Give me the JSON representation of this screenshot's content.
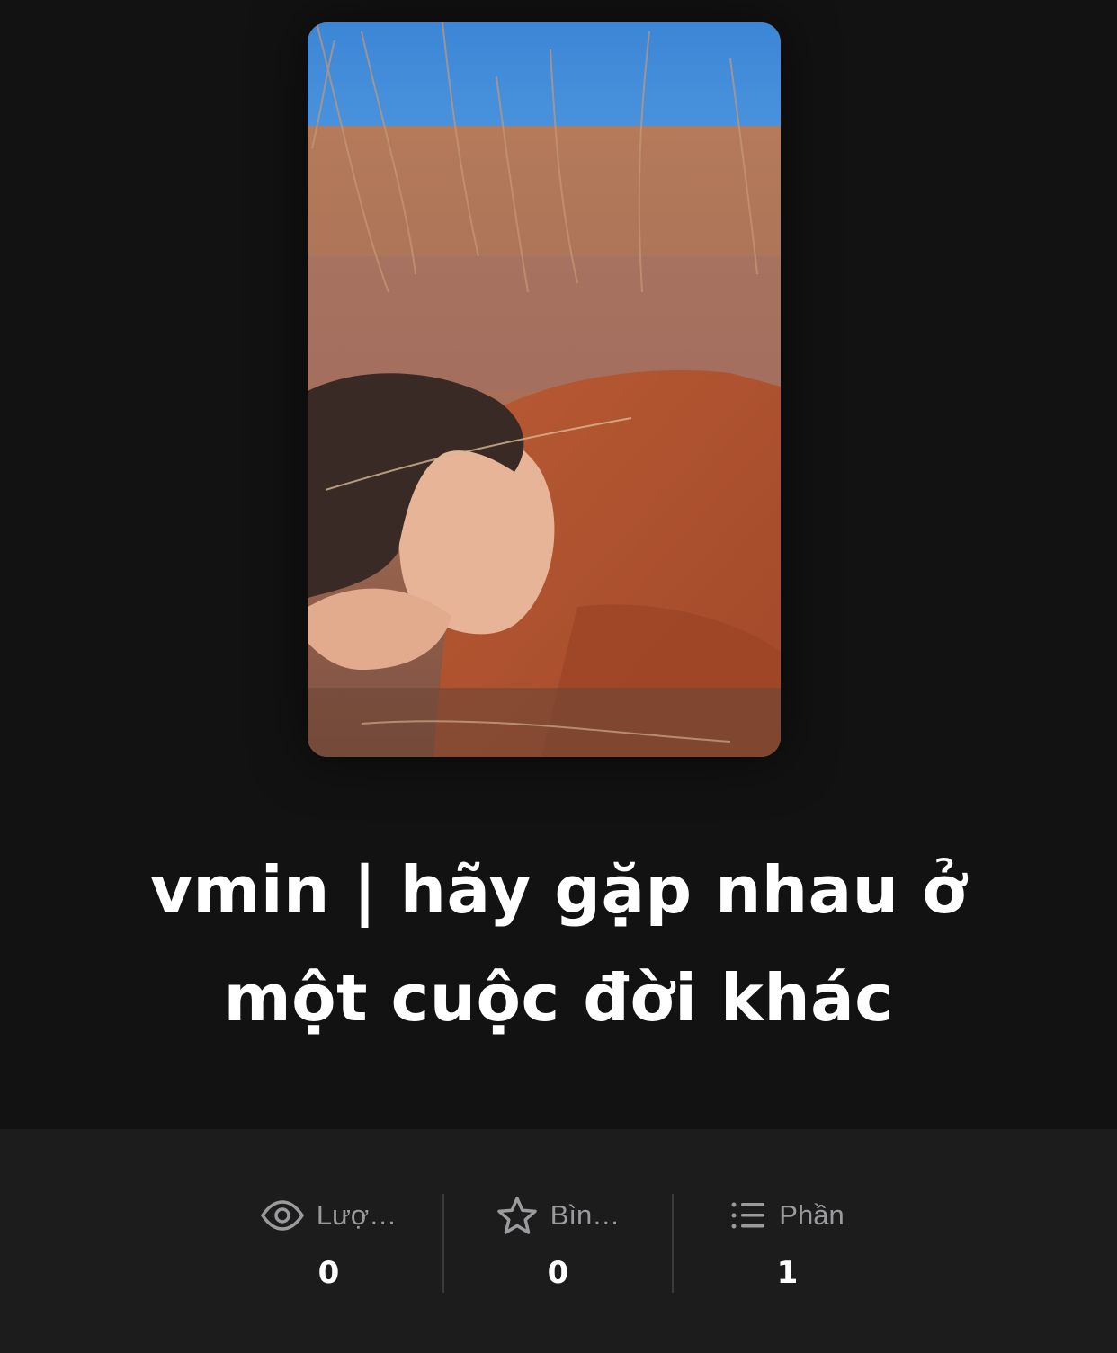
{
  "story": {
    "title": "vmin | hãy gặp nhau ở một cuộc đời khác"
  },
  "stats": [
    {
      "icon": "eye-icon",
      "label": "Lượ…",
      "value": "0"
    },
    {
      "icon": "star-icon",
      "label": "Bìn…",
      "value": "0"
    },
    {
      "icon": "list-icon",
      "label": "Phần",
      "value": "1"
    }
  ],
  "colors": {
    "background": "#121213",
    "stats_background": "#1c1c1d",
    "title_text": "#ffffff",
    "stat_label": "#9b9b9e",
    "divider": "#3a3a3c"
  }
}
